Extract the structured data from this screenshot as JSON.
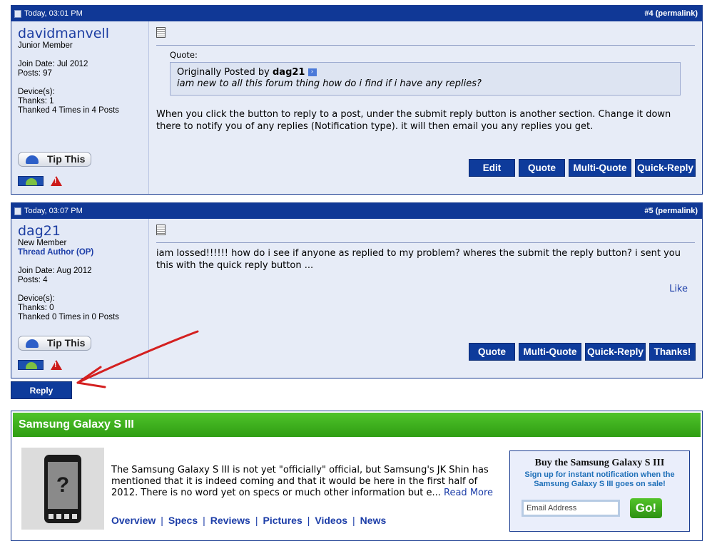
{
  "posts": [
    {
      "date": "Today, 03:01 PM",
      "number": "#4",
      "permalink": "(permalink)",
      "username": "davidmanvell",
      "rank": "Junior Member",
      "op_label": "",
      "join_date": "Join Date: Jul 2012",
      "posts": "Posts: 97",
      "devices": "Device(s):",
      "thanks": "Thanks: 1",
      "thanked": "Thanked 4 Times in 4 Posts",
      "tip_label": "Tip This",
      "quote_label": "Quote:",
      "quote_prefix": "Originally Posted by",
      "quote_author": "dag21",
      "quote_text": "iam new to all this forum thing how do i find if i have any replies?",
      "message": "When you click the button to reply to a post, under the submit reply button is another section. Change it down there to notify you of any replies (Notification type). it will then email you any replies you get.",
      "buttons": [
        "Edit",
        "Quote",
        "Multi-Quote",
        "Quick-Reply"
      ]
    },
    {
      "date": "Today, 03:07 PM",
      "number": "#5",
      "permalink": "(permalink)",
      "username": "dag21",
      "rank": "New Member",
      "op_label": "Thread Author (OP)",
      "join_date": "Join Date: Aug 2012",
      "posts": "Posts: 4",
      "devices": "Device(s):",
      "thanks": "Thanks: 0",
      "thanked": "Thanked 0 Times in 0 Posts",
      "tip_label": "Tip This",
      "message": "iam lossed!!!!!! how do i see if anyone as replied to my problem? wheres the submit the reply button? i sent you this with the quick reply button ...",
      "like_label": "Like",
      "buttons": [
        "Quote",
        "Multi-Quote",
        "Quick-Reply",
        "Thanks!"
      ]
    }
  ],
  "reply_label": "Reply",
  "promo": {
    "title": "Samsung Galaxy S III",
    "text": "The Samsung Galaxy S III is not yet \"officially\" official, but Samsung's JK Shin has mentioned that it is indeed coming and that it would be here in the first half of 2012. There is no word yet on specs or much other information but e...",
    "read_more": "Read More",
    "links": [
      "Overview",
      "Specs",
      "Reviews",
      "Pictures",
      "Videos",
      "News"
    ],
    "buy_title": "Buy the Samsung Galaxy S III",
    "buy_sub": "Sign up for instant notification when the Samsung Galaxy S III goes on sale!",
    "email_placeholder": "Email Address",
    "go_label": "Go!"
  }
}
